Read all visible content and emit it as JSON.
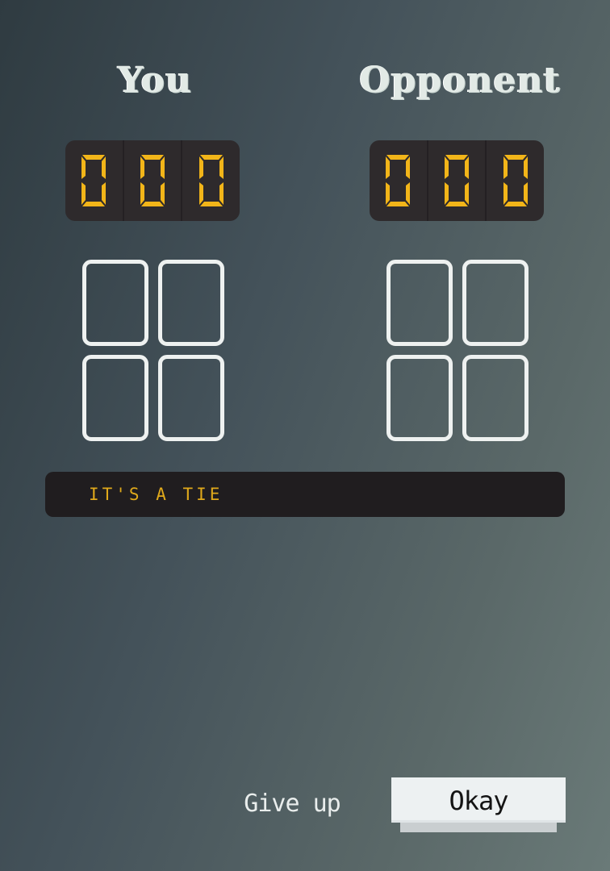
{
  "players": {
    "you": {
      "label": "You",
      "score_digits": [
        "0",
        "0",
        "0"
      ]
    },
    "opponent": {
      "label": "Opponent",
      "score_digits": [
        "0",
        "0",
        "0"
      ]
    }
  },
  "hands": {
    "you": {
      "slot_count": 4,
      "filled": 0
    },
    "opponent": {
      "slot_count": 4,
      "filled": 0
    }
  },
  "status_message": "IT'S A TIE",
  "actions": {
    "give_up_label": "Give up",
    "okay_label": "Okay"
  },
  "colors": {
    "digit": "#f2b519",
    "message": "#e0a91b",
    "card_outline": "#eef1f0"
  }
}
